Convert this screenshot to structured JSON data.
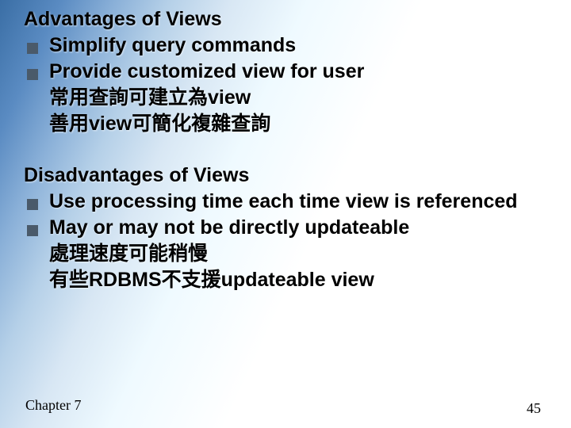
{
  "advantages": {
    "title": "Advantages of Views",
    "bullets": [
      "Simplify query commands",
      "Provide customized view for user"
    ],
    "subs": [
      "常用查詢可建立為view",
      "善用view可簡化複雜查詢"
    ]
  },
  "disadvantages": {
    "title": "Disadvantages of Views",
    "bullets": [
      "Use processing time each time view is referenced",
      "May or may not be directly updateable"
    ],
    "subs": [
      "處理速度可能稍慢",
      "有些RDBMS不支援updateable view"
    ]
  },
  "footer": {
    "chapter": "Chapter 7",
    "page": "45"
  }
}
